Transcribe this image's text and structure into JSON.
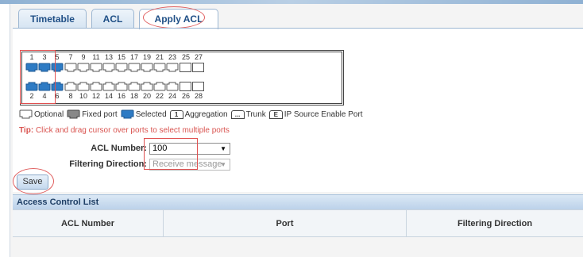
{
  "tabs": [
    {
      "label": "Timetable"
    },
    {
      "label": "ACL"
    },
    {
      "label": "Apply ACL"
    }
  ],
  "ports": {
    "top_numbers": [
      "1",
      "3",
      "5",
      "7",
      "9",
      "11",
      "13",
      "15",
      "17",
      "19",
      "21",
      "23",
      "25",
      "27"
    ],
    "bottom_numbers": [
      "2",
      "4",
      "6",
      "8",
      "10",
      "12",
      "14",
      "16",
      "18",
      "20",
      "22",
      "24",
      "26",
      "28"
    ],
    "selected": [
      "1",
      "2",
      "3",
      "4",
      "5",
      "6"
    ]
  },
  "legend": {
    "optional": "Optional",
    "fixed": "Fixed port",
    "selected": "Selected",
    "aggregation_box": "1",
    "aggregation": "Aggregation",
    "trunk_box": "...",
    "trunk": "Trunk",
    "ipsg_box": "E",
    "ipsg": "IP Source Enable Port"
  },
  "tip": {
    "label": "Tip:",
    "text": "Click and drag cursor over ports to select multiple ports"
  },
  "form": {
    "acl_number_label": "ACL Number:",
    "acl_number_value": "100",
    "filtering_direction_label": "Filtering Direction:",
    "filtering_direction_value": "Receive message"
  },
  "save_label": "Save",
  "acl_list": {
    "title": "Access Control List",
    "columns": [
      "ACL Number",
      "Port",
      "Filtering Direction"
    ]
  },
  "colors": {
    "selected_port": "#2e7bc4",
    "tip_red": "#d9534f",
    "tab_text": "#1f4f86"
  }
}
